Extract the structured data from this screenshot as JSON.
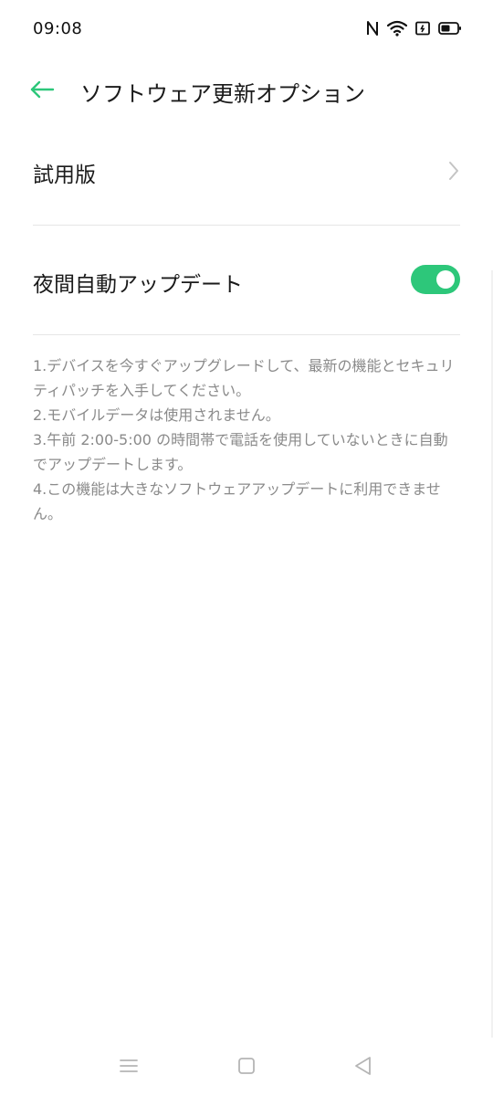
{
  "status_bar": {
    "time": "09:08",
    "icons": [
      "nfc-icon",
      "wifi-icon",
      "sim-icon",
      "battery-icon"
    ]
  },
  "header": {
    "back_icon": "arrow-left-icon",
    "title": "ソフトウェア更新オプション"
  },
  "settings": {
    "beta": {
      "label": "試用版",
      "icon": "chevron-right-icon"
    },
    "night_update": {
      "label": "夜間自動アップデート",
      "enabled": true
    }
  },
  "description": {
    "lines": [
      "1.デバイスを今すぐアップグレードして、最新の機能とセキュリティパッチを入手してください。",
      "2.モバイルデータは使用されません。",
      "3.午前 2:00-5:00 の時間帯で電話を使用していないときに自動でアップデートします。",
      "4.この機能は大きなソフトウェアアップデートに利用できません。"
    ]
  },
  "nav_bar": {
    "icons": [
      "menu-icon",
      "home-icon",
      "back-icon"
    ]
  },
  "colors": {
    "accent": "#2dc77a",
    "text_primary": "#1a1a1a",
    "text_secondary": "#8a8a8a",
    "divider": "#e6e6e6"
  }
}
